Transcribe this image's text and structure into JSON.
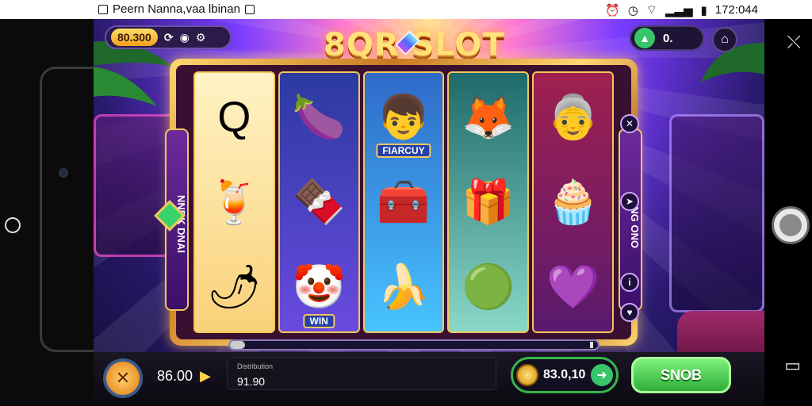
{
  "statusbar": {
    "app_text": "Peern Nanna,vaa lbinan",
    "time": "172:044"
  },
  "header": {
    "balance": "80.300",
    "title": "8QR SLOT",
    "counter": "0.",
    "icons": [
      "refresh-icon",
      "coin-icon",
      "settings-icon",
      "home-icon"
    ]
  },
  "side_panels": {
    "left_text": "NNRK DNAI",
    "right_text": "BNG ONO"
  },
  "reels": [
    {
      "symbols": [
        "Q",
        "🍹",
        "🌶"
      ]
    },
    {
      "symbols": [
        "🍆",
        "🍫",
        "🤡"
      ],
      "label_3": "WIN"
    },
    {
      "symbols": [
        "👦",
        "🧰",
        "🍌"
      ],
      "label_1": "FIARCUY"
    },
    {
      "symbols": [
        "🦊",
        "🎁",
        "🟢"
      ]
    },
    {
      "symbols": [
        "👵",
        "🧁",
        "💜"
      ]
    }
  ],
  "progress": {
    "value": 0.04
  },
  "bottombar": {
    "bet_value": "86.00",
    "info_label": "Distribution",
    "info_value": "91.90",
    "win_value": "83.0,10",
    "spin_label": "SNOB"
  }
}
